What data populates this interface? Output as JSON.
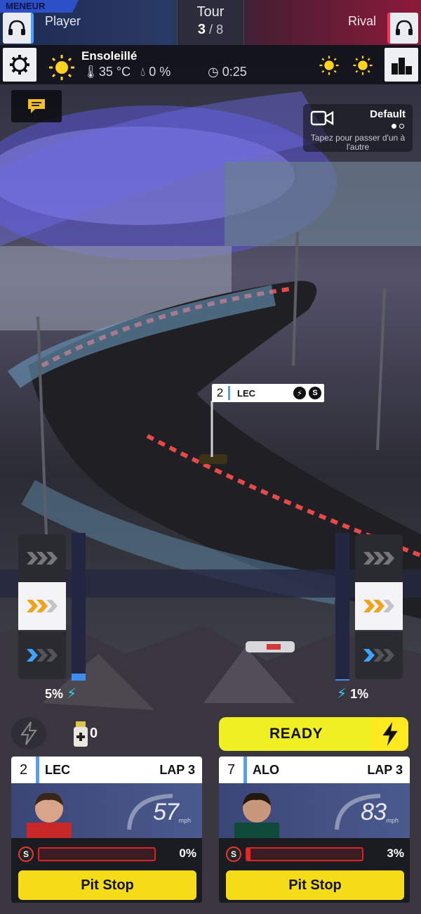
{
  "header": {
    "leader_badge": "MENEUR",
    "player_name": "Player",
    "rival_name": "Rival",
    "lap_title": "Tour",
    "lap_current": "3",
    "lap_sep": " / ",
    "lap_total": "8"
  },
  "weather": {
    "condition": "Ensoleillé",
    "temperature": "35 °C",
    "rain": "0 %",
    "time": "0:25"
  },
  "camera": {
    "label": "Default",
    "hint": "Tapez pour passer d'un à l'autre"
  },
  "track_tag": {
    "position": "2",
    "code": "LEC"
  },
  "ers": {
    "left_percent": "5%",
    "left_level": 0.05,
    "right_percent": "1%",
    "right_level": 0.01
  },
  "boost_count": "0",
  "ready_label": "READY",
  "drivers": [
    {
      "position": "2",
      "code": "LEC",
      "lap": "LAP 3",
      "speed": "57",
      "speed_unit": "mph",
      "tyre": "S",
      "wear": "0%",
      "wear_level": 0.0,
      "pit_label": "Pit Stop"
    },
    {
      "position": "7",
      "code": "ALO",
      "lap": "LAP 3",
      "speed": "83",
      "speed_unit": "mph",
      "tyre": "S",
      "wear": "3%",
      "wear_level": 0.03,
      "pit_label": "Pit Stop"
    }
  ],
  "colors": {
    "player_accent": "#4ea0ff",
    "rival_accent": "#ff3355",
    "ready_yellow": "#f0ef24",
    "ers_blue": "#3e8ff0"
  }
}
